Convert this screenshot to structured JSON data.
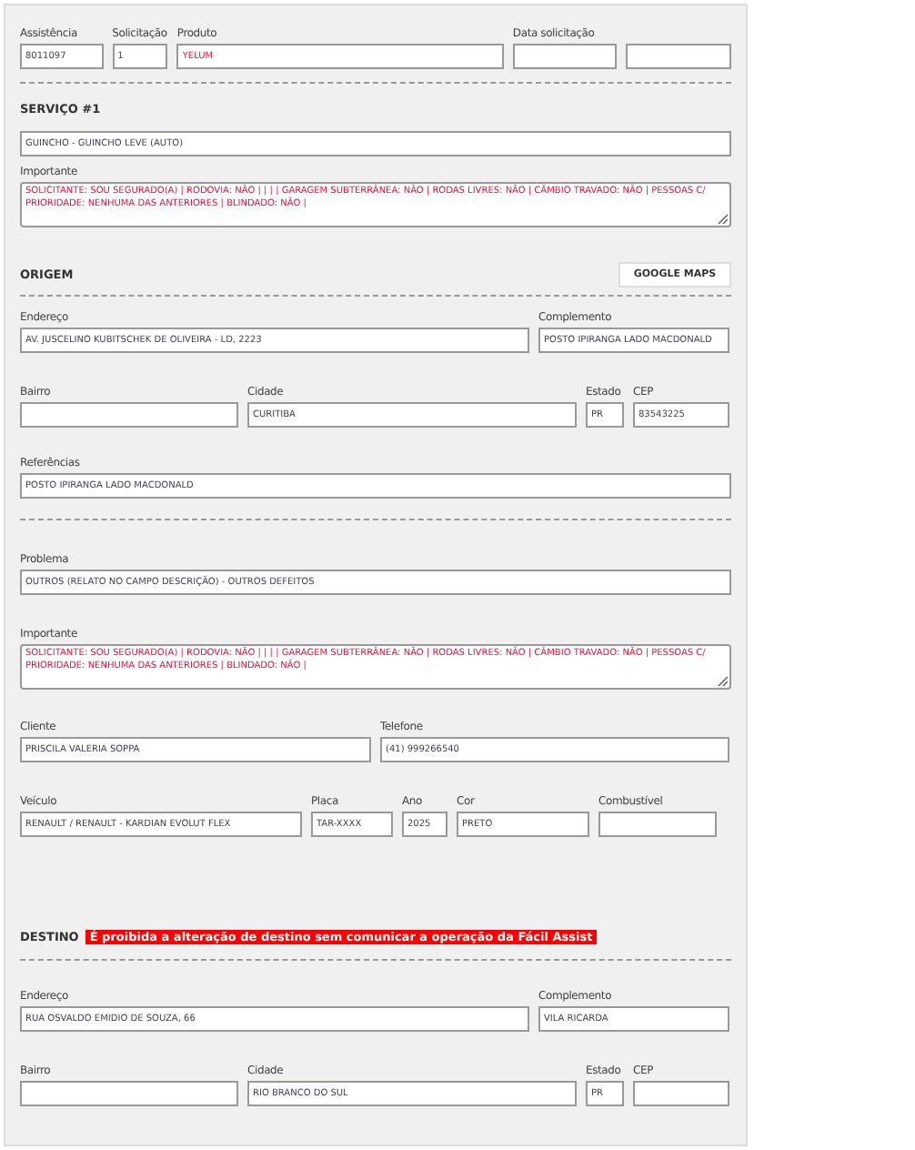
{
  "blocks": [
    {
      "kind": "row",
      "fields": [
        {
          "kind": "input",
          "label": "Assistência",
          "value": "8011097"
        },
        {
          "kind": "input",
          "label": "Solicitação",
          "value": "1"
        },
        {
          "kind": "input",
          "label": "Produto",
          "value": "YELUM",
          "highlight": true
        },
        {
          "kind": "input",
          "label": "Data solicitação"
        },
        {
          "kind": "input"
        }
      ]
    },
    {
      "kind": "divider"
    },
    {
      "kind": "heading",
      "title": "SERVIÇO #1"
    },
    {
      "kind": "row",
      "fields": [
        {
          "kind": "input",
          "value": "GUINCHO - GUINCHO LEVE (AUTO)"
        }
      ]
    },
    {
      "kind": "row",
      "fields": [
        {
          "kind": "textarea",
          "label": "Importante",
          "value": "SOLICITANTE: SOU SEGURADO(A) | RODOVIA: NÃO |  |  |  | GARAGEM SUBTERRÂNEA: NÃO | RODAS LIVRES: NÃO | CÂMBIO TRAVADO: NÃO | PESSOAS C/ PRIORIDADE: NENHUMA DAS ANTERIORES | BLINDADO: NÃO |",
          "highlight": true
        }
      ]
    },
    {
      "kind": "heading",
      "title": "ORIGEM",
      "button": "GOOGLE MAPS"
    },
    {
      "kind": "divider"
    },
    {
      "kind": "row",
      "fields": [
        {
          "kind": "input",
          "label": "Endereço",
          "value": "AV. JUSCELINO KUBITSCHEK DE OLIVEIRA - LD, 2223"
        },
        {
          "kind": "input",
          "label": "Complemento",
          "value": "POSTO IPIRANGA LADO MACDONALD"
        }
      ]
    },
    {
      "kind": "row",
      "fields": [
        {
          "kind": "input",
          "label": "Bairro"
        },
        {
          "kind": "input",
          "label": "Cidade",
          "value": "CURITIBA"
        },
        {
          "kind": "input",
          "label": "Estado",
          "value": "PR"
        },
        {
          "kind": "input",
          "label": "CEP",
          "value": "83543225"
        }
      ]
    },
    {
      "kind": "row",
      "fields": [
        {
          "kind": "input",
          "label": "Referências",
          "value": "POSTO IPIRANGA LADO MACDONALD"
        }
      ]
    },
    {
      "kind": "divider"
    },
    {
      "kind": "row",
      "fields": [
        {
          "kind": "input",
          "label": "Problema",
          "value": "OUTROS (RELATO NO CAMPO DESCRIÇÃO) - OUTROS DEFEITOS"
        }
      ]
    },
    {
      "kind": "row",
      "fields": [
        {
          "kind": "textarea",
          "label": "Importante",
          "value": "SOLICITANTE: SOU SEGURADO(A) | RODOVIA: NÃO |  |  |  | GARAGEM SUBTERRÂNEA: NÃO | RODAS LIVRES: NÃO | CÂMBIO TRAVADO: NÃO | PESSOAS C/ PRIORIDADE: NENHUMA DAS ANTERIORES | BLINDADO: NÃO |",
          "highlight": true
        }
      ]
    },
    {
      "kind": "row",
      "fields": [
        {
          "kind": "input",
          "label": "Cliente",
          "value": "PRISCILA VALERIA SOPPA"
        },
        {
          "kind": "input",
          "label": "Telefone",
          "value": "(41) 999266540"
        }
      ]
    },
    {
      "kind": "row",
      "fields": [
        {
          "kind": "input",
          "label": "Veículo",
          "value": "RENAULT / RENAULT - KARDIAN EVOLUT FLEX"
        },
        {
          "kind": "input",
          "label": "Placa",
          "value": "TAR-XXXX"
        },
        {
          "kind": "input",
          "label": "Ano",
          "value": "2025"
        },
        {
          "kind": "input",
          "label": "Cor",
          "value": "PRETO"
        },
        {
          "kind": "input",
          "label": "Combustível"
        }
      ]
    },
    {
      "kind": "heading",
      "title": "DESTINO",
      "notice": "É proibida a alteração de destino sem comunicar a operação da Fácil Assist"
    },
    {
      "kind": "divider"
    },
    {
      "kind": "row",
      "fields": [
        {
          "kind": "input",
          "label": "Endereço",
          "value": "RUA OSVALDO EMIDIO DE SOUZA, 66"
        },
        {
          "kind": "input",
          "label": "Complemento",
          "value": "VILA RICARDA"
        }
      ]
    },
    {
      "kind": "row",
      "fields": [
        {
          "kind": "input",
          "label": "Bairro"
        },
        {
          "kind": "input",
          "label": "Cidade",
          "value": "RIO BRANCO DO SUL"
        },
        {
          "kind": "input",
          "label": "Estado",
          "value": "PR"
        },
        {
          "kind": "input",
          "label": "CEP"
        }
      ]
    }
  ]
}
